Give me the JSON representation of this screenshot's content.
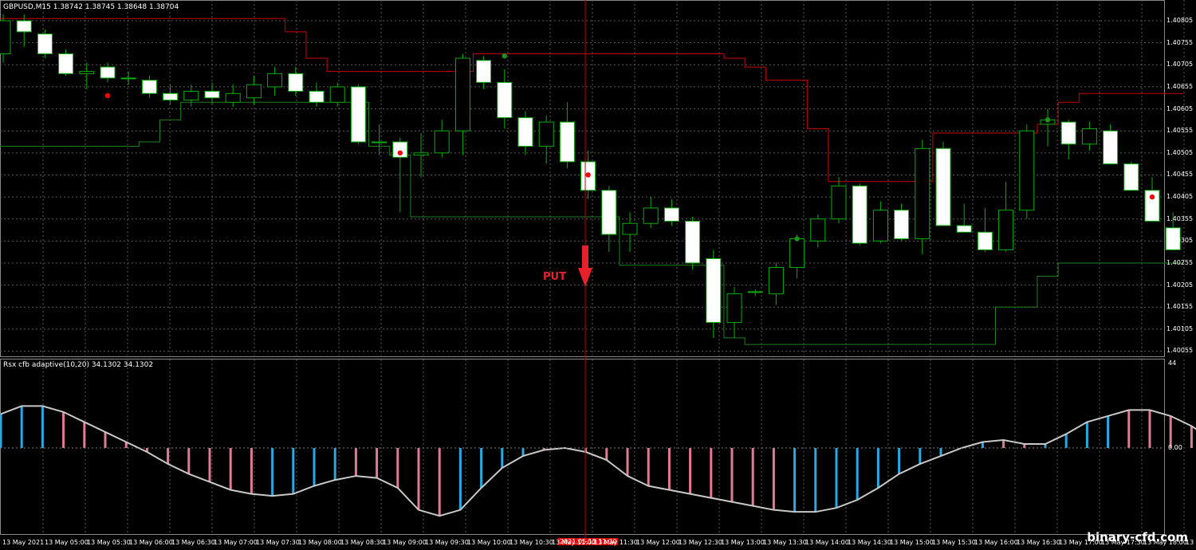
{
  "main_title": "GBPUSD,M15  1.38742 1.38745 1.38648 1.38704",
  "indicator_title": "Rsx cfb adaptive(10,20) 34.1302 34.1302",
  "signal_label": "PUT",
  "cursor_time": "2021.05.13 11:30",
  "watermark": "binary-cfd.com",
  "indicator_scale": [
    "44",
    "0.00"
  ],
  "price_ticks": [
    "1.40805",
    "1.40755",
    "1.40705",
    "1.40655",
    "1.40605",
    "1.40555",
    "1.40505",
    "1.40455",
    "1.40405",
    "1.40355",
    "1.40305",
    "1.40255",
    "1.40205",
    "1.40155",
    "1.40105",
    "1.40055"
  ],
  "time_ticks": [
    "13 May 2021",
    "13 May 05:00",
    "13 May 05:30",
    "13 May 06:00",
    "13 May 06:30",
    "13 May 07:00",
    "13 May 07:30",
    "13 May 08:00",
    "13 May 08:30",
    "13 May 09:00",
    "13 May 09:30",
    "13 May 10:00",
    "13 May 10:30",
    "13 May 11:00",
    "13 May 11:30",
    "13 May 12:00",
    "13 May 12:30",
    "13 May 13:00",
    "13 May 13:30",
    "13 May 14:00",
    "13 May 14:30",
    "13 May 15:00",
    "13 May 15:30",
    "13 May 16:00",
    "13 May 16:30",
    "13 May 17:00",
    "13 May 17:30",
    "13 May 18:00",
    "13 May 18:"
  ],
  "colors": {
    "background": "#000000",
    "grid": "#5a5a5a",
    "bull_body": "#000000",
    "bull_border": "#00b000",
    "bear_body": "#ffffff",
    "wick": "#00b000",
    "upper_band": "#cc0000",
    "lower_band": "#1f7f1f",
    "dot_red": "#ff0000",
    "dot_green": "#1f8f1f",
    "rsx_line": "#c8c8c8",
    "hist_up": "#2aa8e0",
    "hist_down": "#e07a95",
    "cursor": "#c00000",
    "arrow": "#e8202a"
  },
  "chart_data": {
    "type": "candlestick",
    "symbol": "GBPUSD",
    "timeframe": "M15",
    "price_range": [
      1.40045,
      1.40825
    ],
    "candles": [
      {
        "o": 1.4073,
        "h": 1.4082,
        "l": 1.4071,
        "c": 1.40805
      },
      {
        "o": 1.40805,
        "h": 1.4082,
        "l": 1.40745,
        "c": 1.4078
      },
      {
        "o": 1.40775,
        "h": 1.40785,
        "l": 1.4072,
        "c": 1.4073
      },
      {
        "o": 1.4073,
        "h": 1.4074,
        "l": 1.4068,
        "c": 1.40685
      },
      {
        "o": 1.40685,
        "h": 1.4071,
        "l": 1.4065,
        "c": 1.4069
      },
      {
        "o": 1.407,
        "h": 1.4071,
        "l": 1.40665,
        "c": 1.40675
      },
      {
        "o": 1.40675,
        "h": 1.4069,
        "l": 1.4066,
        "c": 1.40675
      },
      {
        "o": 1.4067,
        "h": 1.4068,
        "l": 1.4063,
        "c": 1.4064
      },
      {
        "o": 1.4064,
        "h": 1.4066,
        "l": 1.40615,
        "c": 1.40625
      },
      {
        "o": 1.40625,
        "h": 1.4066,
        "l": 1.4061,
        "c": 1.40645
      },
      {
        "o": 1.40645,
        "h": 1.40665,
        "l": 1.40615,
        "c": 1.4063
      },
      {
        "o": 1.4062,
        "h": 1.4066,
        "l": 1.4061,
        "c": 1.4064
      },
      {
        "o": 1.4063,
        "h": 1.4068,
        "l": 1.40615,
        "c": 1.4066
      },
      {
        "o": 1.40655,
        "h": 1.407,
        "l": 1.40635,
        "c": 1.40685
      },
      {
        "o": 1.40685,
        "h": 1.407,
        "l": 1.40635,
        "c": 1.40645
      },
      {
        "o": 1.40645,
        "h": 1.40665,
        "l": 1.4061,
        "c": 1.4062
      },
      {
        "o": 1.4062,
        "h": 1.40665,
        "l": 1.4061,
        "c": 1.40655
      },
      {
        "o": 1.40655,
        "h": 1.4066,
        "l": 1.40525,
        "c": 1.4053
      },
      {
        "o": 1.4053,
        "h": 1.4057,
        "l": 1.405,
        "c": 1.4053
      },
      {
        "o": 1.4053,
        "h": 1.4054,
        "l": 1.4037,
        "c": 1.40495
      },
      {
        "o": 1.405,
        "h": 1.4055,
        "l": 1.4045,
        "c": 1.40505
      },
      {
        "o": 1.40505,
        "h": 1.4058,
        "l": 1.40495,
        "c": 1.40555
      },
      {
        "o": 1.40555,
        "h": 1.4073,
        "l": 1.405,
        "c": 1.4072
      },
      {
        "o": 1.40715,
        "h": 1.40725,
        "l": 1.4065,
        "c": 1.40665
      },
      {
        "o": 1.40665,
        "h": 1.40695,
        "l": 1.4056,
        "c": 1.40585
      },
      {
        "o": 1.40585,
        "h": 1.406,
        "l": 1.405,
        "c": 1.4052
      },
      {
        "o": 1.4052,
        "h": 1.4059,
        "l": 1.4048,
        "c": 1.40575
      },
      {
        "o": 1.40575,
        "h": 1.4062,
        "l": 1.4047,
        "c": 1.40485
      },
      {
        "o": 1.40485,
        "h": 1.4051,
        "l": 1.404,
        "c": 1.4042
      },
      {
        "o": 1.4042,
        "h": 1.4043,
        "l": 1.4028,
        "c": 1.4032
      },
      {
        "o": 1.4032,
        "h": 1.4037,
        "l": 1.4028,
        "c": 1.40345
      },
      {
        "o": 1.40345,
        "h": 1.40405,
        "l": 1.40335,
        "c": 1.4038
      },
      {
        "o": 1.4038,
        "h": 1.404,
        "l": 1.4034,
        "c": 1.4035
      },
      {
        "o": 1.4035,
        "h": 1.4036,
        "l": 1.4024,
        "c": 1.40255
      },
      {
        "o": 1.40265,
        "h": 1.40285,
        "l": 1.40085,
        "c": 1.4012
      },
      {
        "o": 1.4012,
        "h": 1.402,
        "l": 1.40085,
        "c": 1.40185
      },
      {
        "o": 1.4019,
        "h": 1.40195,
        "l": 1.4018,
        "c": 1.4019
      },
      {
        "o": 1.40185,
        "h": 1.40255,
        "l": 1.4016,
        "c": 1.40245
      },
      {
        "o": 1.40245,
        "h": 1.4032,
        "l": 1.4022,
        "c": 1.4031
      },
      {
        "o": 1.40305,
        "h": 1.40365,
        "l": 1.4029,
        "c": 1.40355
      },
      {
        "o": 1.40355,
        "h": 1.4045,
        "l": 1.40345,
        "c": 1.4043
      },
      {
        "o": 1.4043,
        "h": 1.40435,
        "l": 1.40295,
        "c": 1.403
      },
      {
        "o": 1.40305,
        "h": 1.40395,
        "l": 1.403,
        "c": 1.40375
      },
      {
        "o": 1.40375,
        "h": 1.4039,
        "l": 1.40305,
        "c": 1.4031
      },
      {
        "o": 1.4031,
        "h": 1.40535,
        "l": 1.40275,
        "c": 1.40515
      },
      {
        "o": 1.40515,
        "h": 1.4053,
        "l": 1.4034,
        "c": 1.4034
      },
      {
        "o": 1.4034,
        "h": 1.4039,
        "l": 1.40325,
        "c": 1.40325
      },
      {
        "o": 1.40325,
        "h": 1.4038,
        "l": 1.4028,
        "c": 1.40285
      },
      {
        "o": 1.40285,
        "h": 1.4044,
        "l": 1.4028,
        "c": 1.40375
      },
      {
        "o": 1.40375,
        "h": 1.4057,
        "l": 1.40355,
        "c": 1.40555
      },
      {
        "o": 1.4057,
        "h": 1.40605,
        "l": 1.4052,
        "c": 1.4058
      },
      {
        "o": 1.40575,
        "h": 1.4058,
        "l": 1.4049,
        "c": 1.40525
      },
      {
        "o": 1.40525,
        "h": 1.40575,
        "l": 1.4051,
        "c": 1.4056
      },
      {
        "o": 1.40555,
        "h": 1.4057,
        "l": 1.4048,
        "c": 1.4048
      },
      {
        "o": 1.4048,
        "h": 1.40485,
        "l": 1.4042,
        "c": 1.4042
      },
      {
        "o": 1.4042,
        "h": 1.4045,
        "l": 1.4036,
        "c": 1.4035
      },
      {
        "o": 1.40335,
        "h": 1.4037,
        "l": 1.4029,
        "c": 1.40285
      }
    ],
    "upper_band": [
      1.4081,
      1.4081,
      1.4081,
      1.4081,
      1.4081,
      1.4081,
      1.4081,
      1.4081,
      1.4081,
      1.4081,
      1.4081,
      1.4081,
      1.4081,
      1.4081,
      1.4078,
      1.4072,
      1.4069,
      1.4069,
      1.4069,
      1.4069,
      1.4069,
      1.4069,
      1.4069,
      1.4073,
      1.4073,
      1.4073,
      1.4073,
      1.4073,
      1.4073,
      1.4073,
      1.4073,
      1.4073,
      1.4073,
      1.4073,
      1.4073,
      1.4072,
      1.407,
      1.4067,
      1.4067,
      1.4056,
      1.4044,
      1.4044,
      1.4044,
      1.4044,
      1.4044,
      1.4055,
      1.4055,
      1.4055,
      1.4055,
      1.4055,
      1.4057,
      1.4062,
      1.4064,
      1.4064,
      1.4064,
      1.4064,
      1.4064
    ],
    "lower_band": [
      1.4052,
      1.4052,
      1.4052,
      1.4052,
      1.4052,
      1.4052,
      1.4052,
      1.4053,
      1.4058,
      1.4062,
      1.4062,
      1.4062,
      1.4062,
      1.4062,
      1.4062,
      1.4062,
      1.4062,
      1.4062,
      1.4052,
      1.405,
      1.4036,
      1.4036,
      1.4036,
      1.4036,
      1.4036,
      1.4036,
      1.4036,
      1.4036,
      1.4036,
      1.4036,
      1.4025,
      1.4025,
      1.4025,
      1.4025,
      1.4025,
      1.40085,
      1.4007,
      1.4007,
      1.4007,
      1.4007,
      1.4007,
      1.4007,
      1.4007,
      1.4007,
      1.4007,
      1.4007,
      1.4007,
      1.4007,
      1.40155,
      1.40155,
      1.40225,
      1.40255,
      1.40255,
      1.40255,
      1.40255,
      1.40255,
      1.40255
    ],
    "markers": [
      {
        "i": 5,
        "price": 1.40635,
        "color": "red"
      },
      {
        "i": 19,
        "price": 1.40505,
        "color": "red"
      },
      {
        "i": 24,
        "price": 1.40725,
        "color": "green"
      },
      {
        "i": 28,
        "price": 1.40455,
        "color": "red"
      },
      {
        "i": 38,
        "price": 1.4031,
        "color": "green"
      },
      {
        "i": 50,
        "price": 1.4058,
        "color": "green"
      },
      {
        "i": 55,
        "price": 1.40405,
        "color": "red"
      }
    ],
    "indicator": {
      "name": "Rsx cfb adaptive(10,20)",
      "range": [
        -44,
        44
      ],
      "rsx": [
        17,
        21,
        21,
        18,
        13,
        8,
        3,
        -2,
        -8,
        -13,
        -17,
        -21,
        -23,
        -24,
        -23,
        -19,
        -16,
        -14,
        -15,
        -20,
        -31,
        -34,
        -31,
        -20,
        -10,
        -4,
        -1,
        0,
        -2,
        -6,
        -14,
        -19,
        -21,
        -23,
        -25,
        -27,
        -29,
        -31,
        -32,
        -32,
        -30,
        -26,
        -20,
        -13,
        -8,
        -4,
        0,
        3,
        4,
        2,
        2,
        7,
        13,
        16,
        19,
        19,
        16,
        11,
        4
      ],
      "colors": [
        "up",
        "up",
        "up",
        "down",
        "down",
        "down",
        "down",
        "down",
        "down",
        "down",
        "down",
        "down",
        "down",
        "up",
        "up",
        "up",
        "up",
        "down",
        "down",
        "down",
        "down",
        "down",
        "up",
        "up",
        "up",
        "up",
        "down",
        "down",
        "down",
        "down",
        "down",
        "down",
        "down",
        "down",
        "down",
        "down",
        "down",
        "down",
        "up",
        "up",
        "up",
        "up",
        "up",
        "up",
        "up",
        "up",
        "up",
        "up",
        "down",
        "down",
        "up",
        "up",
        "up",
        "up",
        "down",
        "down",
        "down",
        "down",
        "down"
      ]
    }
  }
}
